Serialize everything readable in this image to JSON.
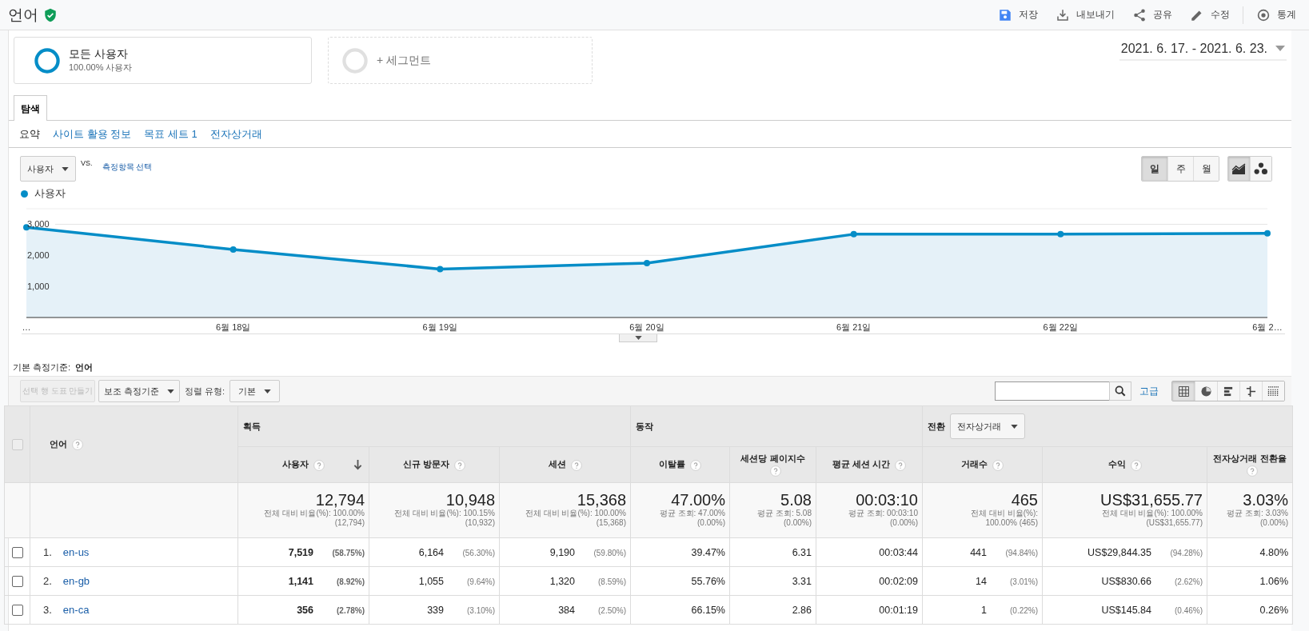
{
  "header": {
    "title": "언어",
    "verified": true,
    "actions": [
      {
        "kind": "save",
        "label": "저장"
      },
      {
        "kind": "export",
        "label": "내보내기"
      },
      {
        "kind": "share",
        "label": "공유"
      },
      {
        "kind": "edit",
        "label": "수정"
      },
      {
        "kind": "insights",
        "label": "통계"
      }
    ]
  },
  "segments": [
    {
      "kind": "active",
      "name": "모든 사용자",
      "detail": "100.00% 사용자"
    },
    {
      "kind": "add",
      "name": "+ 세그먼트"
    }
  ],
  "date_range": "2021. 6. 17. - 2021. 6. 23.",
  "tabs": [
    {
      "label": "탐색",
      "selected": true
    }
  ],
  "subnav": [
    {
      "label": "요약",
      "selected": true
    },
    {
      "label": "사이트 활용 정보",
      "selected": false
    },
    {
      "label": "목표 세트 1",
      "selected": false
    },
    {
      "label": "전자상거래",
      "selected": false
    }
  ],
  "metric_select": "사용자",
  "vs": "VS.",
  "compare_link": "측정항목 선택",
  "period_buttons": [
    {
      "label": "일",
      "selected": true
    },
    {
      "label": "주",
      "selected": false
    },
    {
      "label": "월",
      "selected": false
    }
  ],
  "chart_types": [
    {
      "kind": "line",
      "selected": true
    },
    {
      "kind": "motion",
      "selected": false
    }
  ],
  "chart": {
    "chart_data": {
      "type": "area",
      "categories": [
        "…",
        "6월 18일",
        "6월 19일",
        "6월 20일",
        "6월 21일",
        "6월 22일",
        "6월 2…"
      ],
      "series": [
        {
          "name": "사용자",
          "color": "#058dc7",
          "values": [
            2900,
            2190,
            1560,
            1750,
            2680,
            2680,
            2710
          ]
        }
      ],
      "ylim": [
        0,
        3500
      ],
      "yticks": [
        {
          "value": 1000,
          "label": "1,000"
        },
        {
          "value": 2000,
          "label": "2,000"
        },
        {
          "value": 3000,
          "label": "3,000"
        }
      ]
    }
  },
  "primary_dimension": {
    "label": "기본 측정기준:",
    "value": "언어"
  },
  "toolbar": {
    "plot_rows": {
      "label": "선택 행 도표 만들기",
      "disabled": true
    },
    "secondary": "보조 측정기준",
    "sort_label": "정렬 유형:",
    "sort_value": "기본",
    "advanced": "고급"
  },
  "view_modes": [
    {
      "kind": "table",
      "selected": true
    },
    {
      "kind": "pie",
      "selected": false
    },
    {
      "kind": "bar",
      "selected": false
    },
    {
      "kind": "comparison",
      "selected": false
    },
    {
      "kind": "pivot",
      "selected": false
    }
  ],
  "table": {
    "dimension": "언어",
    "all_checked": false,
    "groups": [
      {
        "label": "획득",
        "columns": [
          {
            "label": "사용자",
            "sorted": true
          },
          {
            "label": "신규 방문자",
            "sorted": false
          },
          {
            "label": "세션",
            "sorted": false
          }
        ]
      },
      {
        "label": "동작",
        "columns": [
          {
            "label": "이탈률",
            "sorted": false
          },
          {
            "label": "세션당 페이지수",
            "sorted": false
          },
          {
            "label": "평균 세션 시간",
            "sorted": false
          }
        ]
      },
      {
        "label": "전환",
        "select": "전자상거래",
        "columns": [
          {
            "label": "거래수",
            "sorted": false
          },
          {
            "label": "수익",
            "sorted": false
          },
          {
            "label": "전자상거래 전환율",
            "sorted": false
          }
        ]
      }
    ],
    "totals": [
      {
        "value": "12,794",
        "sub": [
          "전체 대비 비율(%): 100.00%",
          "(12,794)"
        ]
      },
      {
        "value": "10,948",
        "sub": [
          "전체 대비 비율(%): 100.15%",
          "(10,932)"
        ]
      },
      {
        "value": "15,368",
        "sub": [
          "전체 대비 비율(%): 100.00%",
          "(15,368)"
        ]
      },
      {
        "value": "47.00%",
        "sub": [
          "평균 조회: 47.00%",
          "(0.00%)"
        ]
      },
      {
        "value": "5.08",
        "sub": [
          "평균 조회: 5.08",
          "(0.00%)"
        ]
      },
      {
        "value": "00:03:10",
        "sub": [
          "평균 조회: 00:03:10",
          "(0.00%)"
        ]
      },
      {
        "value": "465",
        "sub": [
          "전체 대비 비율(%):",
          "100.00% (465)"
        ]
      },
      {
        "value": "US$31,655.77",
        "sub": [
          "전체 대비 비율(%): 100.00%",
          "(US$31,655.77)"
        ]
      },
      {
        "value": "3.03%",
        "sub": [
          "평균 조회: 3.03%",
          "(0.00%)"
        ]
      }
    ],
    "rows": [
      {
        "rank": "1.",
        "name": "en-us",
        "checked": false,
        "cells": [
          {
            "value": "7,519",
            "pct": "(58.75%)"
          },
          {
            "value": "6,164",
            "pct": "(56.30%)"
          },
          {
            "value": "9,190",
            "pct": "(59.80%)"
          },
          {
            "value": "39.47%"
          },
          {
            "value": "6.31"
          },
          {
            "value": "00:03:44"
          },
          {
            "value": "441",
            "pct": "(94.84%)"
          },
          {
            "value": "US$29,844.35",
            "pct": "(94.28%)"
          },
          {
            "value": "4.80%"
          }
        ]
      },
      {
        "rank": "2.",
        "name": "en-gb",
        "checked": false,
        "cells": [
          {
            "value": "1,141",
            "pct": "(8.92%)"
          },
          {
            "value": "1,055",
            "pct": "(9.64%)"
          },
          {
            "value": "1,320",
            "pct": "(8.59%)"
          },
          {
            "value": "55.76%"
          },
          {
            "value": "3.31"
          },
          {
            "value": "00:02:09"
          },
          {
            "value": "14",
            "pct": "(3.01%)"
          },
          {
            "value": "US$830.66",
            "pct": "(2.62%)"
          },
          {
            "value": "1.06%"
          }
        ]
      },
      {
        "rank": "3.",
        "name": "en-ca",
        "checked": false,
        "cells": [
          {
            "value": "356",
            "pct": "(2.78%)"
          },
          {
            "value": "339",
            "pct": "(3.10%)"
          },
          {
            "value": "384",
            "pct": "(2.50%)"
          },
          {
            "value": "66.15%"
          },
          {
            "value": "2.86"
          },
          {
            "value": "00:01:19"
          },
          {
            "value": "1",
            "pct": "(0.22%)"
          },
          {
            "value": "US$145.84",
            "pct": "(0.46%)"
          },
          {
            "value": "0.26%"
          }
        ]
      }
    ]
  }
}
